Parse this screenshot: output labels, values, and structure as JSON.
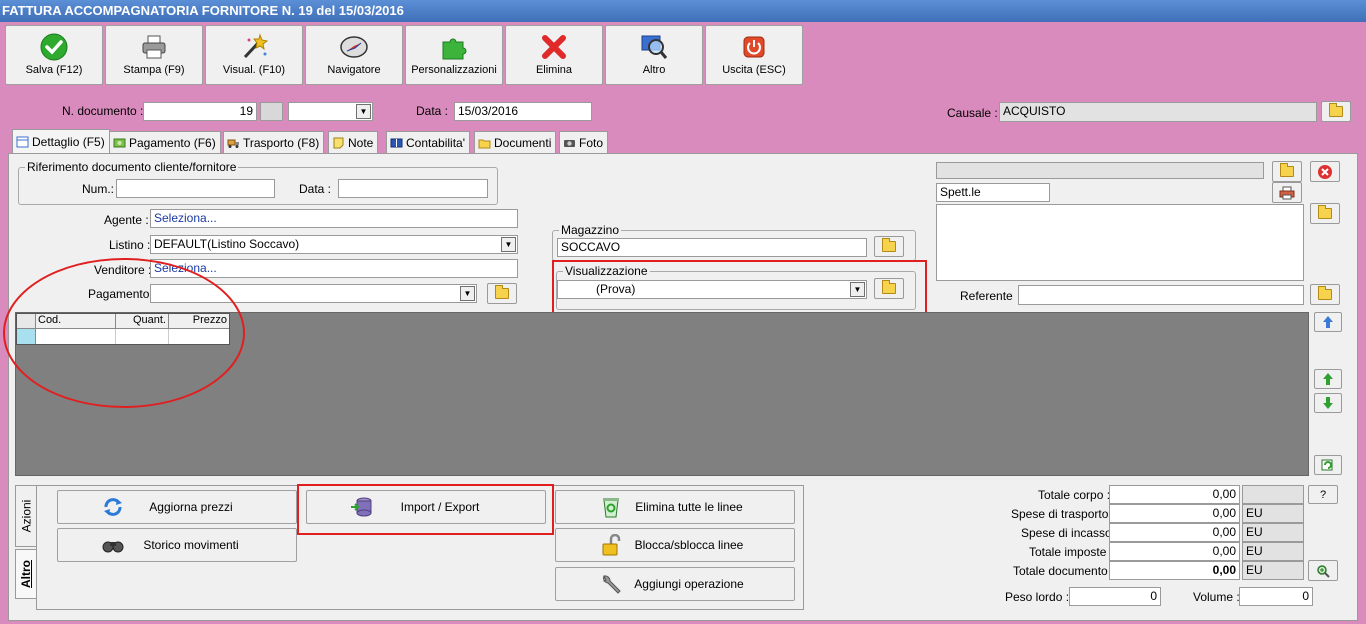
{
  "window": {
    "title": "FATTURA ACCOMPAGNATORIA FORNITORE N. 19 del 15/03/2016"
  },
  "toolbar": {
    "buttons": [
      {
        "label": "Salva (F12)",
        "icon": "check-icon"
      },
      {
        "label": "Stampa (F9)",
        "icon": "printer-icon"
      },
      {
        "label": "Visual. (F10)",
        "icon": "magic-wand-icon"
      },
      {
        "label": "Navigatore",
        "icon": "compass-icon"
      },
      {
        "label": "Personalizzazioni",
        "icon": "puzzle-icon"
      },
      {
        "label": "Elimina",
        "icon": "red-x-icon"
      },
      {
        "label": "Altro",
        "icon": "magnifier-icon"
      },
      {
        "label": "Uscita (ESC)",
        "icon": "power-icon"
      }
    ]
  },
  "header": {
    "ndoc_label": "N. documento :",
    "ndoc_value": "19",
    "data_label": "Data :",
    "data_value": "15/03/2016",
    "causale_label": "Causale :",
    "causale_value": "ACQUISTO"
  },
  "tabs": [
    {
      "label": "Dettaglio (F5)",
      "icon": "document-icon",
      "active": true
    },
    {
      "label": "Pagamento (F6)",
      "icon": "money-icon"
    },
    {
      "label": "Trasporto (F8)",
      "icon": "truck-icon"
    },
    {
      "label": "Note",
      "icon": "note-icon"
    },
    {
      "label": "Contabilita'",
      "icon": "book-icon"
    },
    {
      "label": "Documenti",
      "icon": "folder-icon"
    },
    {
      "label": "Foto",
      "icon": "camera-icon"
    }
  ],
  "riferimento": {
    "title": "Riferimento documento cliente/fornitore",
    "num_label": "Num.:",
    "num_value": "",
    "data_label": "Data :",
    "data_value": ""
  },
  "form": {
    "agente_label": "Agente :",
    "agente_value": "Seleziona...",
    "listino_label": "Listino :",
    "listino_value": "DEFAULT(Listino Soccavo)",
    "venditore_label": "Venditore :",
    "venditore_value": "Seleziona...",
    "pagamento_label": "Pagamento :",
    "pagamento_value": ""
  },
  "magazzino": {
    "title": "Magazzino",
    "value": "SOCCAVO"
  },
  "visualizzazione": {
    "title": "Visualizzazione",
    "value": "(Prova)"
  },
  "cliente": {
    "spett_value": "Spett.le",
    "referente_label": "Referente",
    "referente_value": ""
  },
  "grid": {
    "columns": [
      "Cod.",
      "Quant.",
      "Prezzo"
    ]
  },
  "actions": {
    "tab_azioni": "Azioni",
    "tab_altro": "Altro",
    "buttons": [
      {
        "label": "Aggiorna prezzi",
        "icon": "refresh-icon"
      },
      {
        "label": "Storico movimenti",
        "icon": "binoculars-icon"
      },
      {
        "label": "Import / Export",
        "icon": "database-icon"
      },
      {
        "label": "Elimina tutte le linee",
        "icon": "recycle-bin-icon"
      },
      {
        "label": "Blocca/sblocca linee",
        "icon": "padlock-icon"
      },
      {
        "label": "Aggiungi operazione",
        "icon": "wrench-icon"
      }
    ]
  },
  "totals": {
    "corpo_label": "Totale corpo :",
    "corpo_value": "0,00",
    "help_label": "?",
    "trasporto_label": "Spese di trasporto :",
    "trasporto_value": "0,00",
    "trasporto_unit": "EU",
    "incasso_label": "Spese di incasso :",
    "incasso_value": "0,00",
    "incasso_unit": "EU",
    "imposte_label": "Totale imposte :",
    "imposte_value": "0,00",
    "imposte_unit": "EU",
    "documento_label": "Totale documento :",
    "documento_value": "0,00",
    "documento_unit": "EU",
    "peso_label": "Peso lordo :",
    "peso_value": "0",
    "volume_label": "Volume :",
    "volume_value": "0"
  },
  "colors": {
    "background": "#d98bbd",
    "title_bar": "#4a7fc8",
    "panel": "#f0f0f0",
    "grid": "#808080",
    "highlight": "#e02020"
  }
}
